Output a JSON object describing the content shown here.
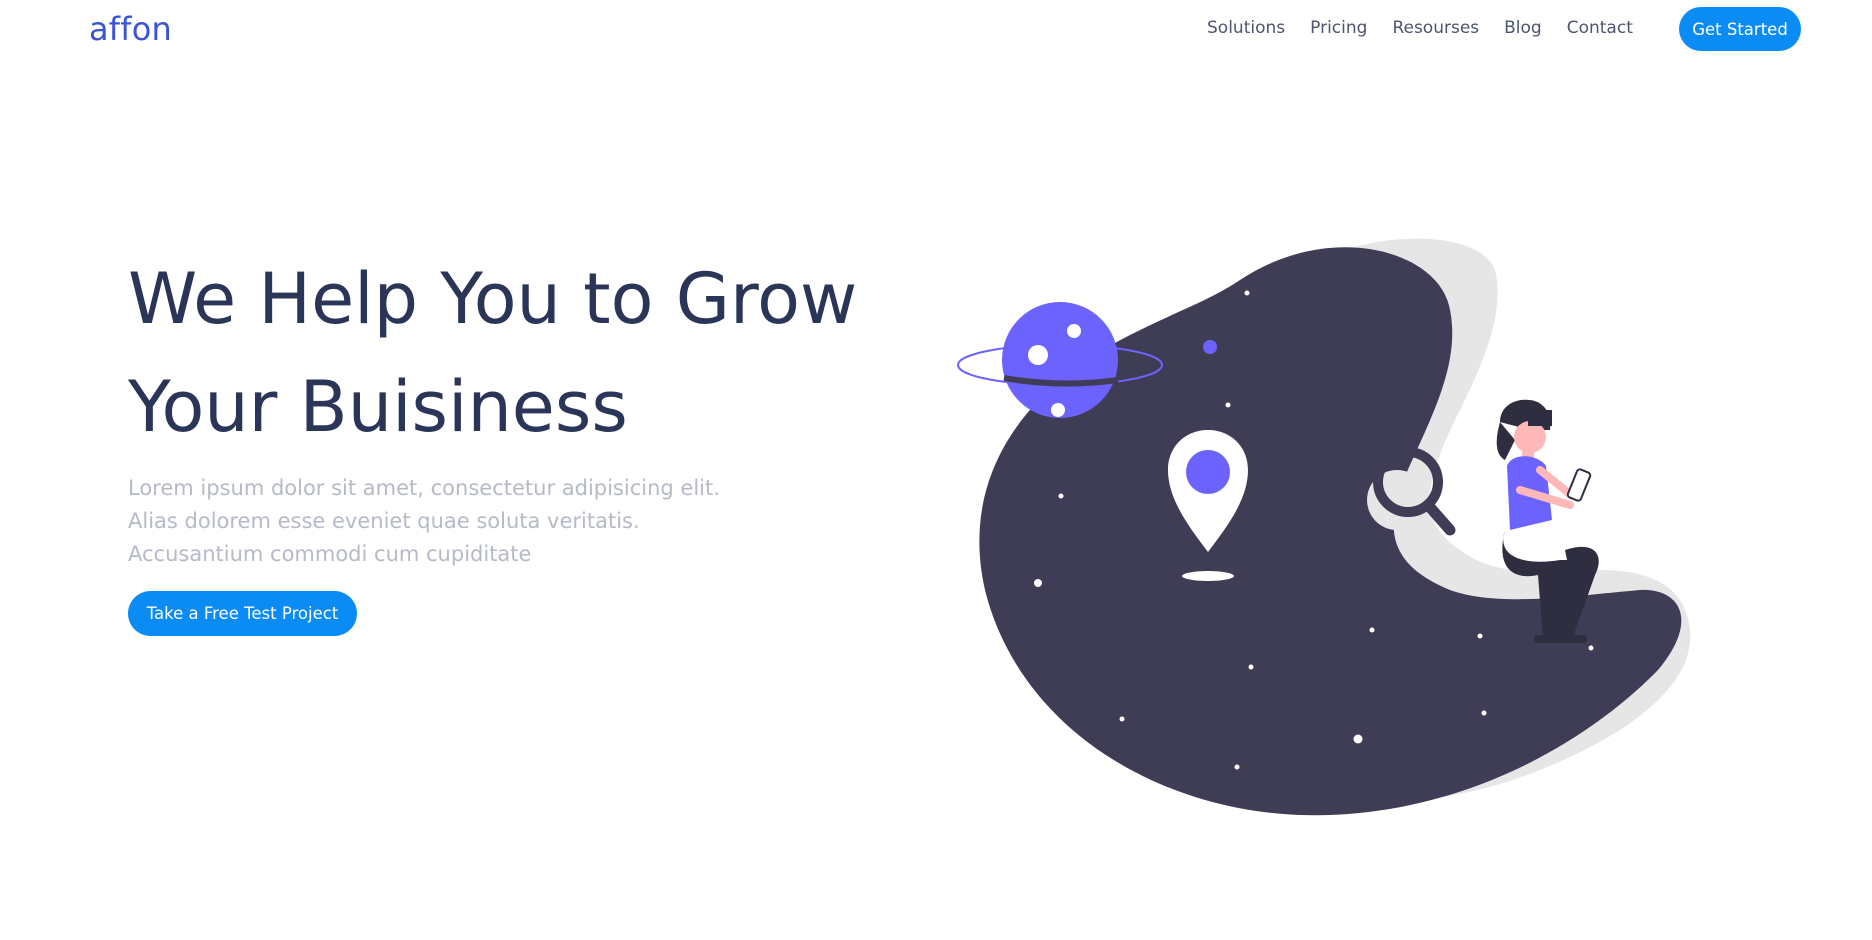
{
  "brand": {
    "logo_text": "affon",
    "color": "#3a54d6"
  },
  "nav": {
    "items": [
      {
        "label": "Solutions"
      },
      {
        "label": "Pricing"
      },
      {
        "label": "Resourses"
      },
      {
        "label": "Blog"
      },
      {
        "label": "Contact"
      }
    ],
    "cta_label": "Get Started"
  },
  "hero": {
    "title_line1": "We Help You to Grow",
    "title_line2": "Your Buisiness",
    "description": "Lorem ipsum dolor sit amet, consectetur adipisicing elit. Alias dolorem esse eveniet quae soluta veritatis. Accusantium commodi cum cupiditate",
    "button_label": "Take a Free Test Project"
  },
  "colors": {
    "accent": "#0b8cf5",
    "heading": "#2a3558",
    "muted_text": "#b6bac7",
    "blob_dark": "#3f3d56",
    "blob_shadow": "#e6e6e6",
    "purple": "#6c63ff"
  },
  "illustration": {
    "icons": [
      "planet-icon",
      "map-pin-icon",
      "magnifier-icon",
      "person-with-phone"
    ]
  }
}
